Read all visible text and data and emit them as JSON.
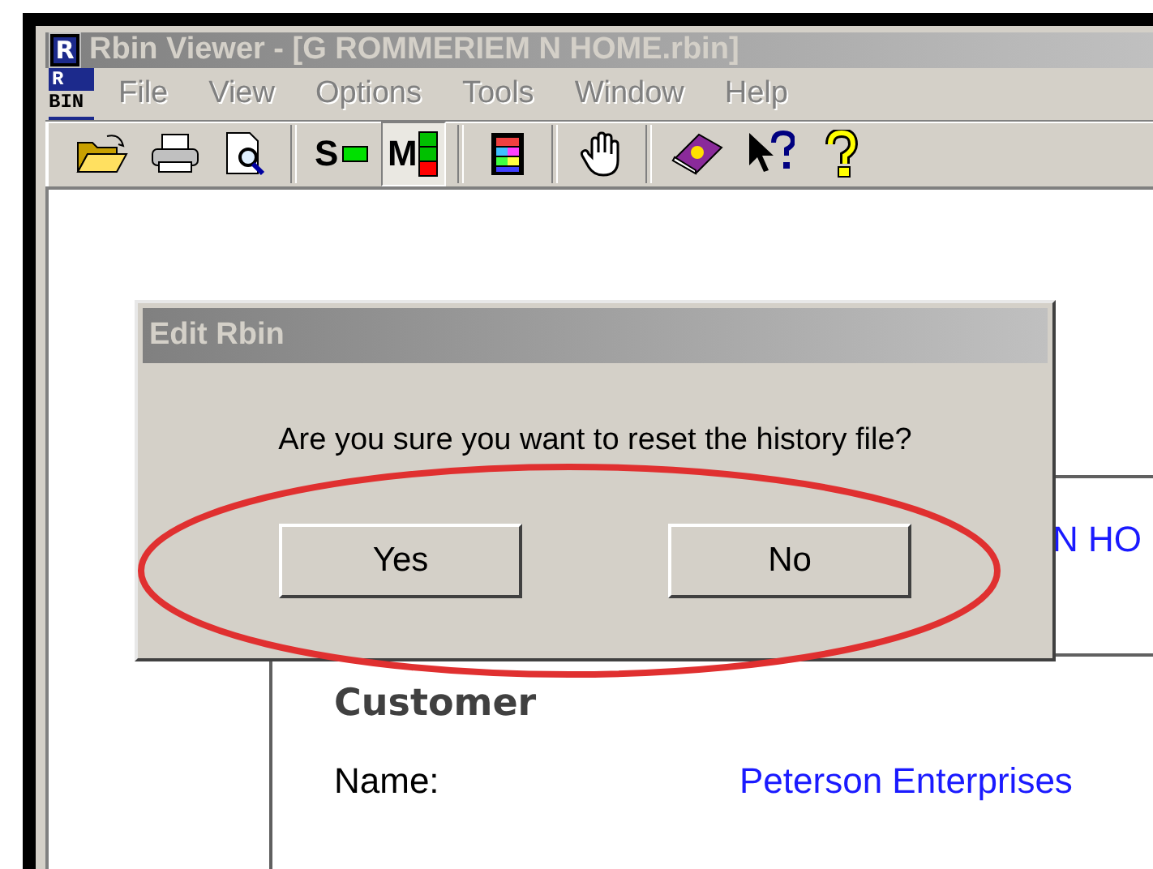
{
  "window": {
    "icon_letter": "R",
    "title": "Rbin Viewer - [G ROMMERIEM N HOME.rbin]"
  },
  "menu": {
    "logo_lines": [
      "R",
      "BIN"
    ],
    "items": [
      {
        "label": "File",
        "disabled": true
      },
      {
        "label": "View",
        "disabled": true
      },
      {
        "label": "Options",
        "disabled": true
      },
      {
        "label": "Tools",
        "disabled": true
      },
      {
        "label": "Window",
        "disabled": true
      },
      {
        "label": "Help",
        "disabled": true
      }
    ]
  },
  "toolbar": [
    {
      "kind": "folder",
      "selected": false
    },
    {
      "kind": "printer",
      "selected": false
    },
    {
      "kind": "preview",
      "selected": false
    },
    {
      "kind": "separator"
    },
    {
      "kind": "letter",
      "label": "S",
      "selected": false
    },
    {
      "kind": "letter",
      "label": "M",
      "selected": true
    },
    {
      "kind": "separator"
    },
    {
      "kind": "palette",
      "selected": false
    },
    {
      "kind": "separator"
    },
    {
      "kind": "hand",
      "selected": false
    },
    {
      "kind": "separator"
    },
    {
      "kind": "book",
      "selected": false
    },
    {
      "kind": "pointer-help",
      "selected": false
    },
    {
      "kind": "question",
      "selected": false
    }
  ],
  "document": {
    "heading": "N HO",
    "section": "Customer",
    "fields": [
      {
        "label": "Name:",
        "value": "Peterson Enterprises"
      }
    ]
  },
  "dialog": {
    "title": "Edit Rbin",
    "message": "Are you sure you want to reset the history file?",
    "buttons": [
      "Yes",
      "No"
    ]
  }
}
